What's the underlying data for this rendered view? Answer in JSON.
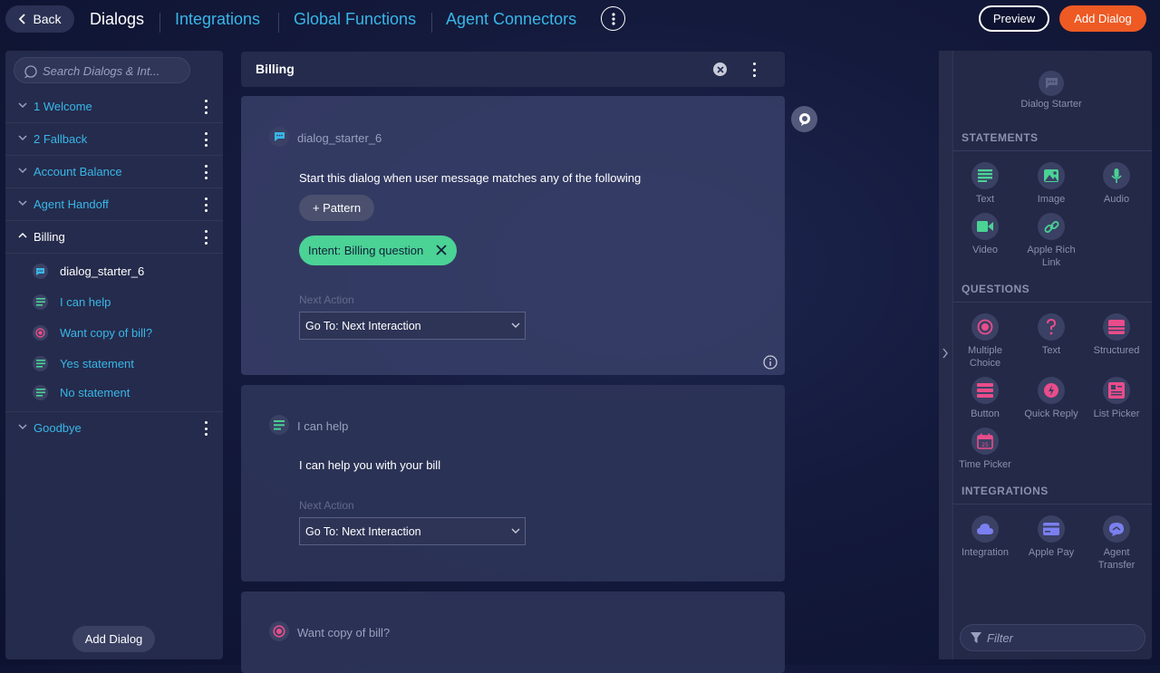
{
  "topbar": {
    "back_label": "Back",
    "title": "Dialogs",
    "nav": [
      "Integrations",
      "Global Functions",
      "Agent Connectors"
    ],
    "preview_label": "Preview",
    "add_dialog_label": "Add Dialog"
  },
  "sidebar": {
    "search_placeholder": "Search Dialogs & Int...",
    "dialogs": [
      {
        "label": "1 Welcome",
        "expanded": false
      },
      {
        "label": "2 Fallback",
        "expanded": false
      },
      {
        "label": "Account Balance",
        "expanded": false
      },
      {
        "label": "Agent Handoff",
        "expanded": false
      },
      {
        "label": "Billing",
        "expanded": true
      },
      {
        "label": "Goodbye",
        "expanded": false
      }
    ],
    "billing_items": [
      {
        "label": "dialog_starter_6",
        "icon": "dialog-starter-icon"
      },
      {
        "label": "I can help",
        "icon": "text-statement-icon"
      },
      {
        "label": "Want copy of bill?",
        "icon": "multiple-choice-icon"
      },
      {
        "label": "Yes statement",
        "icon": "text-statement-icon"
      },
      {
        "label": "No statement",
        "icon": "text-statement-icon"
      }
    ],
    "add_dialog_label": "Add Dialog"
  },
  "canvas": {
    "header_title": "Billing",
    "card1": {
      "title": "dialog_starter_6",
      "description": "Start this dialog when user message matches any of the following",
      "pattern_button": "+ Pattern",
      "intent_chip": "Intent:  Billing question",
      "next_action_label": "Next Action",
      "next_action_value": "Go To: Next Interaction"
    },
    "card2": {
      "title": "I can help",
      "message": "I can help you with your bill",
      "next_action_label": "Next Action",
      "next_action_value": "Go To: Next Interaction"
    },
    "card3": {
      "title": "Want copy of bill?"
    }
  },
  "palette": {
    "dialog_starter": "Dialog Starter",
    "statements_title": "STATEMENTS",
    "statements": [
      "Text",
      "Image",
      "Audio",
      "Video",
      "Apple Rich Link"
    ],
    "questions_title": "QUESTIONS",
    "questions": [
      "Multiple Choice",
      "Text",
      "Structured",
      "Button",
      "Quick Reply",
      "List Picker",
      "Time Picker"
    ],
    "integrations_title": "INTEGRATIONS",
    "integrations": [
      "Integration",
      "Apple Pay",
      "Agent Transfer"
    ],
    "filter_placeholder": "Filter"
  },
  "colors": {
    "accent_blue": "#38b7e8",
    "accent_orange": "#ee5a24",
    "intent_green": "#4bd295",
    "statement_green": "#4bd295",
    "question_pink": "#e94c8a",
    "integration_purple": "#7b7ff0"
  }
}
